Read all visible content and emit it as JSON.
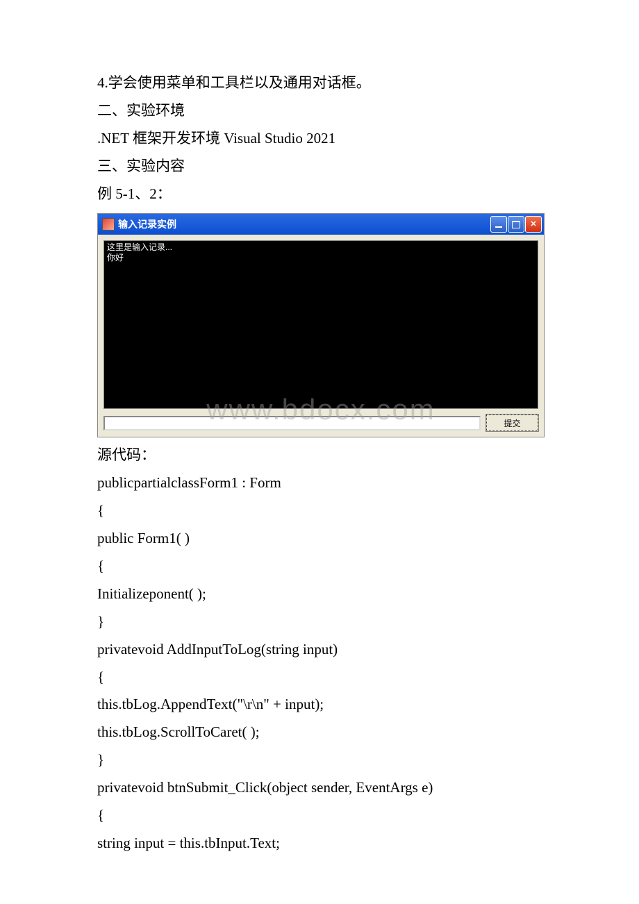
{
  "paragraphs": {
    "p1": "4.学会使用菜单和工具栏以及通用对话框。",
    "p2": "二、实验环境",
    "p3": ".NET 框架开发环境 Visual Studio 2021",
    "p4": "三、实验内容",
    "p5": "例 5-1、2："
  },
  "window": {
    "title": "输入记录实例",
    "log_line1": "这里是输入记录...",
    "log_line2": "你好",
    "submit_label": "提交"
  },
  "watermark": "www.bdocx.com",
  "source_code_heading": "源代码：",
  "code": {
    "l1": "publicpartialclassForm1 : Form",
    "l2": " {",
    "l3": "public Form1( )",
    "l4": " {",
    "l5": " Initializeponent( );",
    "l6": " }",
    "l7": "privatevoid AddInputToLog(string input)",
    "l8": " {",
    "l9": "this.tbLog.AppendText(\"\\r\\n\" + input);",
    "l10": "this.tbLog.ScrollToCaret( );",
    "l11": " }",
    "l12": "privatevoid btnSubmit_Click(object sender, EventArgs e)",
    "l13": " {",
    "l14": "string input = this.tbInput.Text;"
  }
}
